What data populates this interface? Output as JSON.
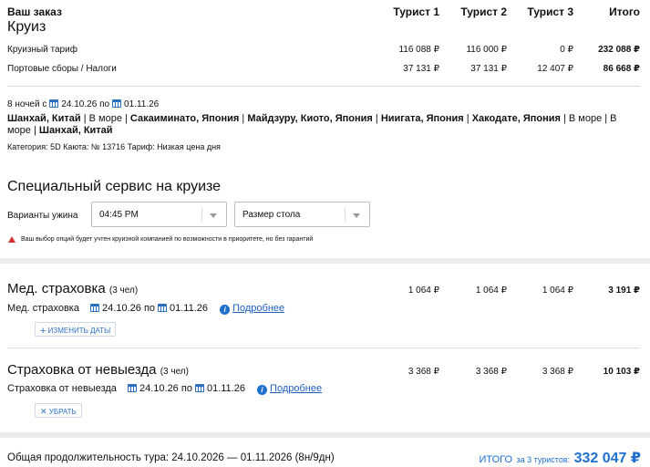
{
  "order": {
    "title": "Ваш заказ",
    "subtitle": "Круиз",
    "columns": [
      "Турист 1",
      "Турист 2",
      "Турист 3",
      "Итого"
    ],
    "rows": [
      {
        "label": "Круизный тариф",
        "values": [
          "116 088 ₽",
          "116 000 ₽",
          "0 ₽",
          "232 088 ₽"
        ]
      },
      {
        "label": "Портовые сборы / Налоги",
        "values": [
          "37 131 ₽",
          "37 131 ₽",
          "12 407 ₽",
          "86 668 ₽"
        ]
      }
    ]
  },
  "itinerary": {
    "nights_prefix": "8 ночей с",
    "date_from": "24.10.26",
    "by": "по",
    "date_to": "01.11.26",
    "route_line1": "<b>Шанхай, Китай</b> | В море | <b>Сакаиминато, Япония</b> | <b>Майдзуру, Киото, Япония</b> | <b>Ниигата, Япония</b> | <b>Хакодате, Япония</b> | В море | В",
    "route_line2": "море | <b>Шанхай, Китай</b>",
    "details": "Категория: 5D  Каюта: № 13716  Тариф: Низкая цена дня"
  },
  "service": {
    "title": "Специальный сервис на круизе",
    "dinner_label": "Варианты ужина",
    "dinner_value": "04:45 PM",
    "table_value": "Размер стола",
    "warning": "Ваш выбор опций будет учтен круизной компанией по возможности в приоритете, но без гарантий"
  },
  "medical": {
    "title": "Мед. страховка",
    "people": "(3 чел)",
    "values": [
      "1 064 ₽",
      "1 064 ₽",
      "1 064 ₽",
      "3 191 ₽"
    ],
    "sub_label": "Мед. страховка",
    "date_from": "24.10.26",
    "by": "по",
    "date_to": "01.11.26",
    "more": "Подробнее",
    "change_dates": "ИЗМЕНИТЬ ДАТЫ"
  },
  "cancel": {
    "title": "Страховка от невыезда",
    "people": "(3 чел)",
    "values": [
      "3 368 ₽",
      "3 368 ₽",
      "3 368 ₽",
      "10 103 ₽"
    ],
    "sub_label": "Страховка от невыезда",
    "date_from": "24.10.26",
    "by": "по",
    "date_to": "01.11.26",
    "more": "Подробнее",
    "remove": "УБРАТЬ"
  },
  "footer": {
    "duration": "Общая продолжительность тура: 24.10.2026 — 01.11.2026 (8н/9дн)",
    "total_label": "ИТОГО",
    "total_for": "за 3 туристов:",
    "total_value": "332 047 ₽"
  },
  "colors": {
    "accent": "#1f6fcf",
    "warning": "#d32f2f"
  }
}
